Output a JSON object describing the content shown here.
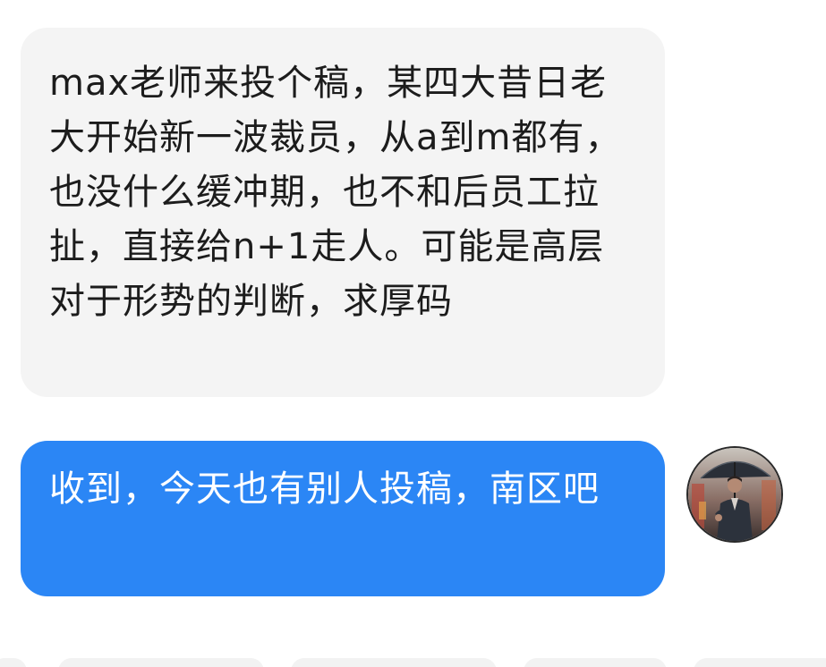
{
  "messages": [
    {
      "direction": "incoming",
      "text": "max老师来投个稿，某四大昔日老大开始新一波裁员，从a到m都有，也没什么缓冲期，也不和后员工拉扯，直接给n+1走人。可能是高层对于形势的判断，求厚码"
    },
    {
      "direction": "outgoing",
      "text": "收到，今天也有别人投稿，南区吧"
    }
  ],
  "colors": {
    "incoming_bubble": "#f4f4f4",
    "outgoing_bubble": "#2b86f5",
    "incoming_text": "#1c1c1c",
    "outgoing_text": "#ffffff"
  },
  "avatar": {
    "icon": "avatar-man-with-umbrella"
  }
}
